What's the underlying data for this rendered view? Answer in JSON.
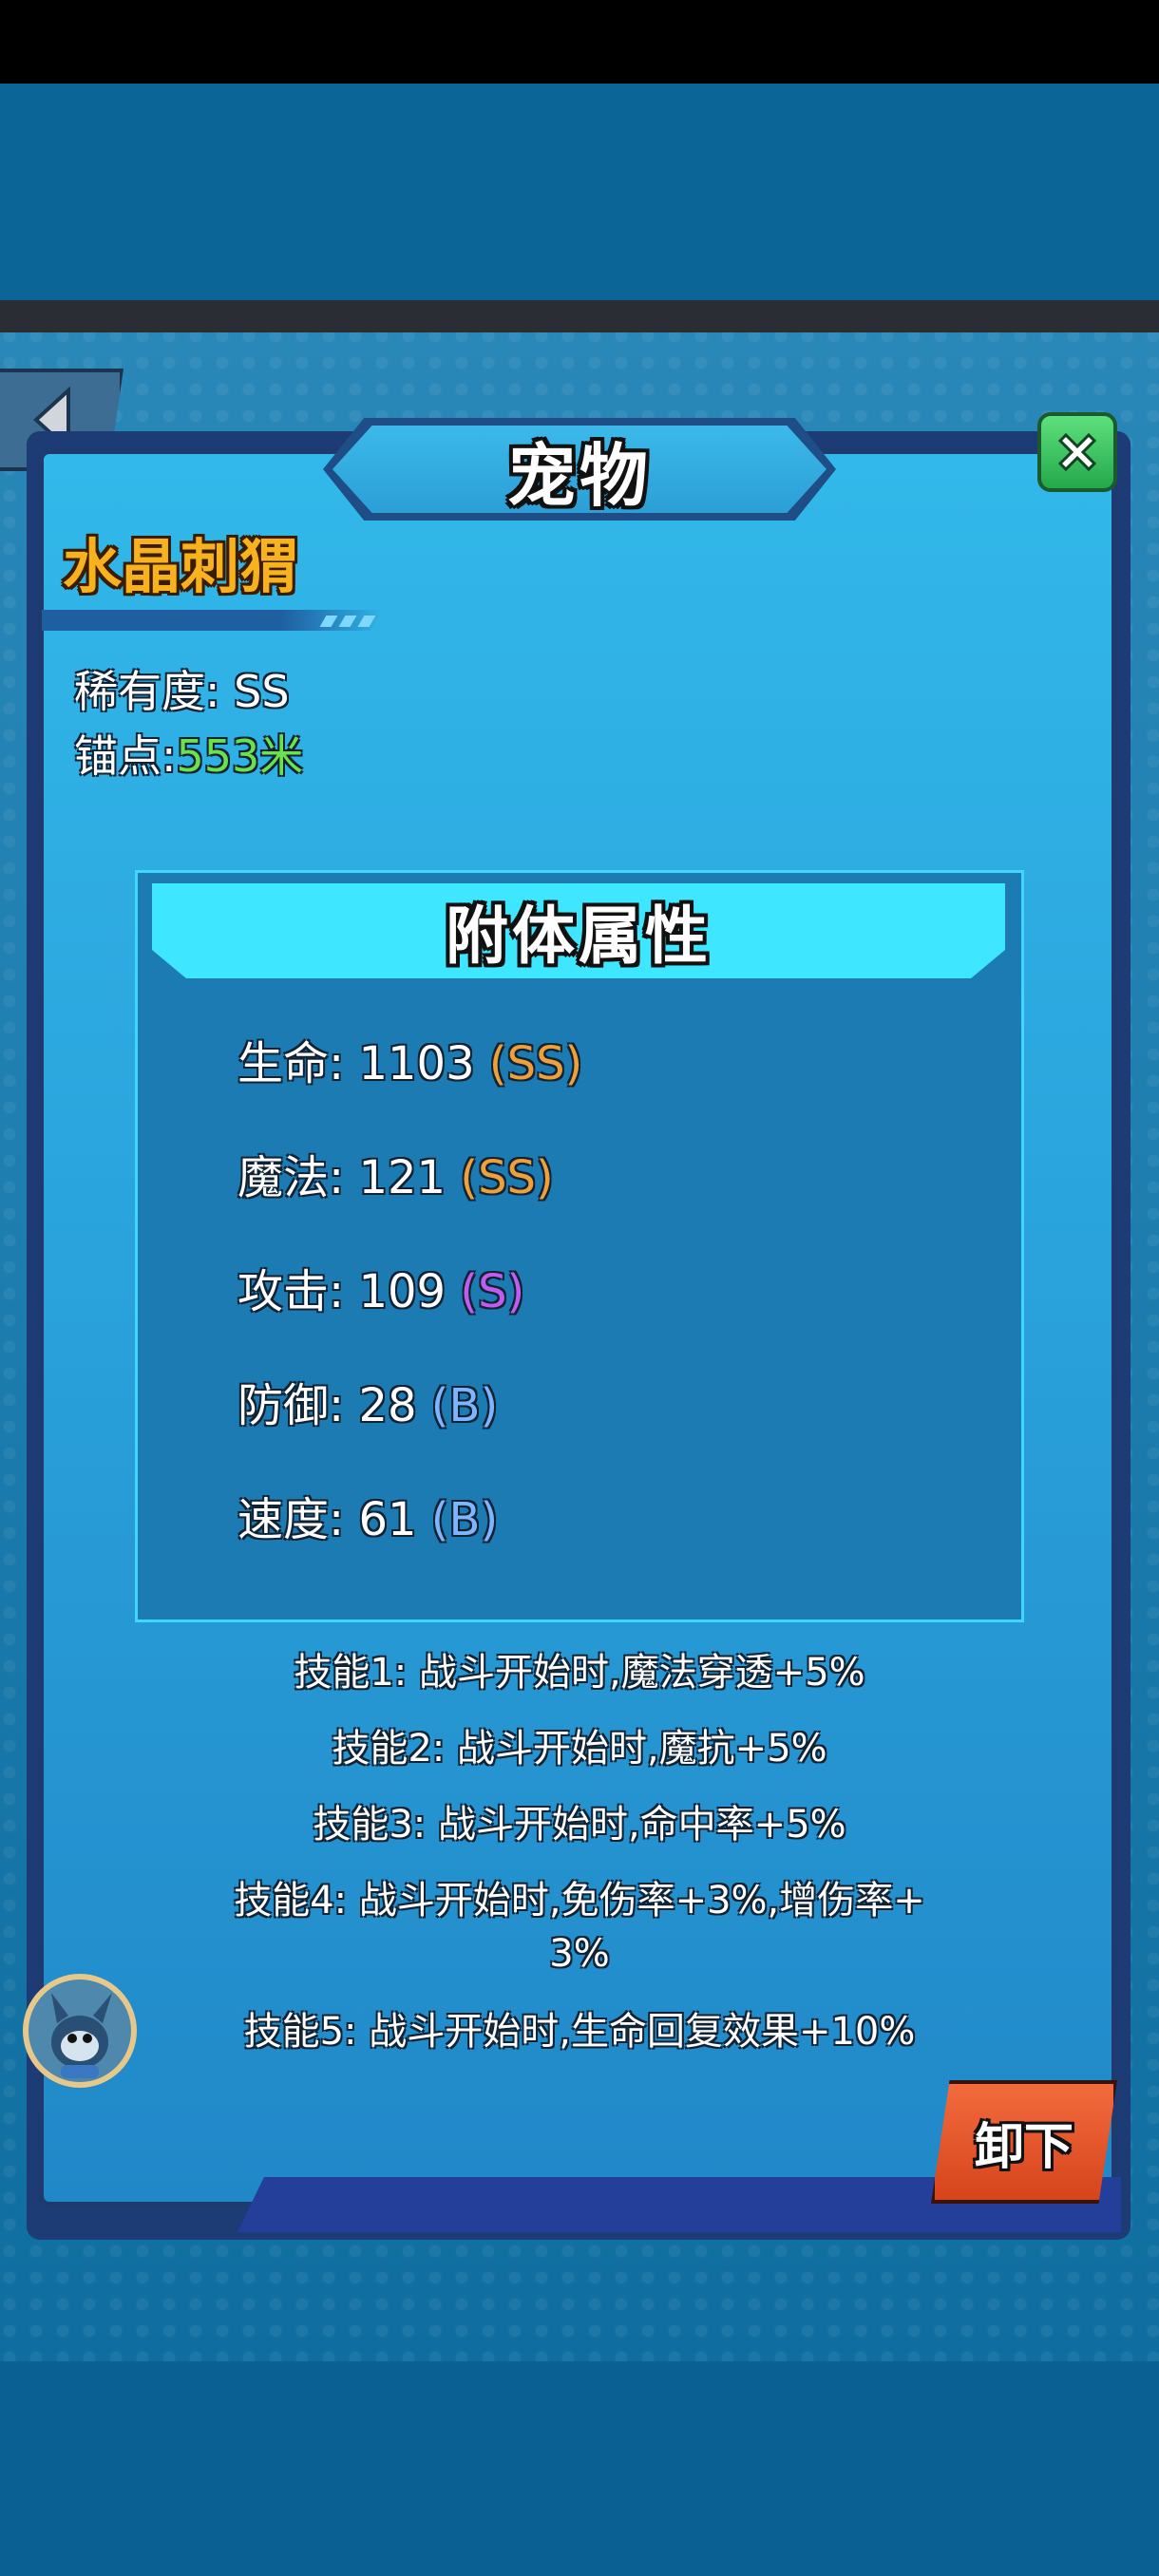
{
  "dialog": {
    "title": "宠物",
    "close_icon": "close-icon",
    "back_icon": "back-arrow-icon"
  },
  "pet": {
    "name": "水晶刺猬",
    "rarity_label": "稀有度:",
    "rarity_value": "SS",
    "anchor_label": "锚点:",
    "anchor_value": "553米"
  },
  "attributes": {
    "header": "附体属性",
    "rows": [
      {
        "label": "生命:",
        "value": "1103",
        "grade": "(SS)"
      },
      {
        "label": "魔法:",
        "value": "121",
        "grade": "(SS)"
      },
      {
        "label": "攻击:",
        "value": "109",
        "grade": "(S)"
      },
      {
        "label": "防御:",
        "value": "28",
        "grade": "(B)"
      },
      {
        "label": "速度:",
        "value": "61",
        "grade": "(B)"
      }
    ]
  },
  "skills": [
    "技能1: 战斗开始时,魔法穿透+5%",
    "技能2: 战斗开始时,魔抗+5%",
    "技能3: 战斗开始时,命中率+5%",
    "技能4: 战斗开始时,免伤率+3%,增伤率+",
    "3%",
    "技能5: 战斗开始时,生命回复效果+10%"
  ],
  "actions": {
    "unequip_label": "卸下"
  },
  "colors": {
    "panel": "#2aa3dc",
    "name_gold": "#f7b21d",
    "anchor_green": "#6be24c",
    "grade_ss": "#f0a03a",
    "grade_s": "#c25cf0",
    "grade_b": "#7fb4ff",
    "button_orange": "#e3552a"
  }
}
